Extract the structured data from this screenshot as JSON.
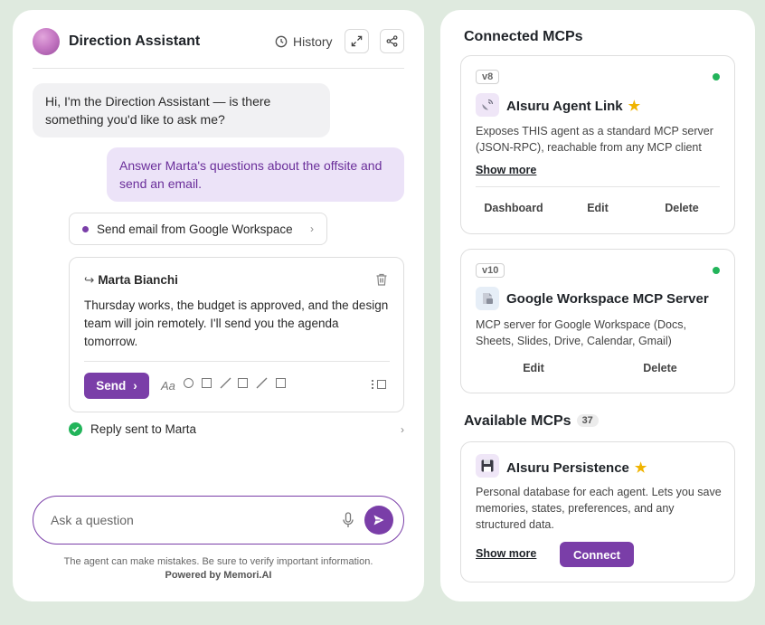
{
  "chat": {
    "title": "Direction Assistant",
    "history_label": "History",
    "assistant_greeting": "Hi, I'm the Direction Assistant — is there something you'd like to ask me?",
    "user_message": "Answer Marta's questions about the offsite and send an email.",
    "tool_call_label": "Send email from Google Workspace",
    "email": {
      "recipient": "Marta Bianchi",
      "body": "Thursday works, the budget is approved, and the design team will join remotely. I'll send you the agenda tomorrow.",
      "send_label": "Send",
      "format_text_label": "Aa"
    },
    "result_label": "Reply sent to Marta",
    "input_placeholder": "Ask a question",
    "disclaimer": "The agent can make mistakes. Be sure to verify important information.",
    "powered_by": "Powered by Memori.AI",
    "accent_color": "#7a3ea8"
  },
  "connected": {
    "title": "Connected MCPs",
    "cards": [
      {
        "version": "v8",
        "icon": "satellite-antenna-icon",
        "name": "AIsuru Agent Link",
        "starred": true,
        "status": "online",
        "description": "Exposes THIS agent as a standard MCP server (JSON-RPC), reachable from any MCP client",
        "show_more": "Show more",
        "actions": [
          "Dashboard",
          "Edit",
          "Delete"
        ]
      },
      {
        "version": "v10",
        "icon": "workspace-icon",
        "name": "Google Workspace MCP Server",
        "starred": false,
        "status": "online",
        "description": "MCP server for Google Workspace (Docs, Sheets, Slides, Drive, Calendar, Gmail)",
        "actions": [
          "Edit",
          "Delete"
        ]
      }
    ]
  },
  "available": {
    "title": "Available MCPs",
    "count": "37",
    "cards": [
      {
        "icon": "floppy-disk-icon",
        "name": "AIsuru Persistence",
        "starred": true,
        "description": "Personal database for each agent. Lets you save memories, states, preferences, and any structured data.",
        "show_more": "Show more",
        "connect_label": "Connect"
      }
    ]
  }
}
